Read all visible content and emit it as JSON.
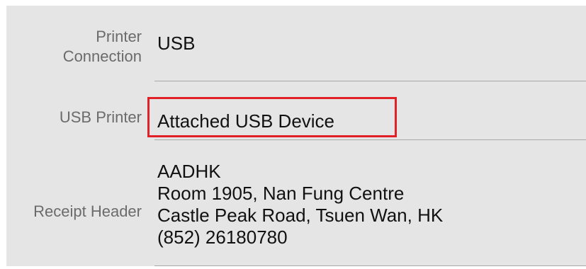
{
  "colors": {
    "panel_background": "#e5e5e5",
    "label_text": "#6b6b6b",
    "value_text": "#111111",
    "divider": "#a9a9a9",
    "highlight_border": "#e02128"
  },
  "fields": {
    "printer_connection": {
      "label_line1": "Printer",
      "label_line2": "Connection",
      "value": "USB"
    },
    "usb_printer": {
      "label": "USB Printer",
      "value": "Attached USB Device"
    },
    "receipt_header": {
      "label": "Receipt Header",
      "lines": [
        "AADHK",
        "Room 1905, Nan Fung Centre",
        "Castle Peak Road, Tsuen Wan, HK",
        "(852) 26180780"
      ]
    }
  }
}
